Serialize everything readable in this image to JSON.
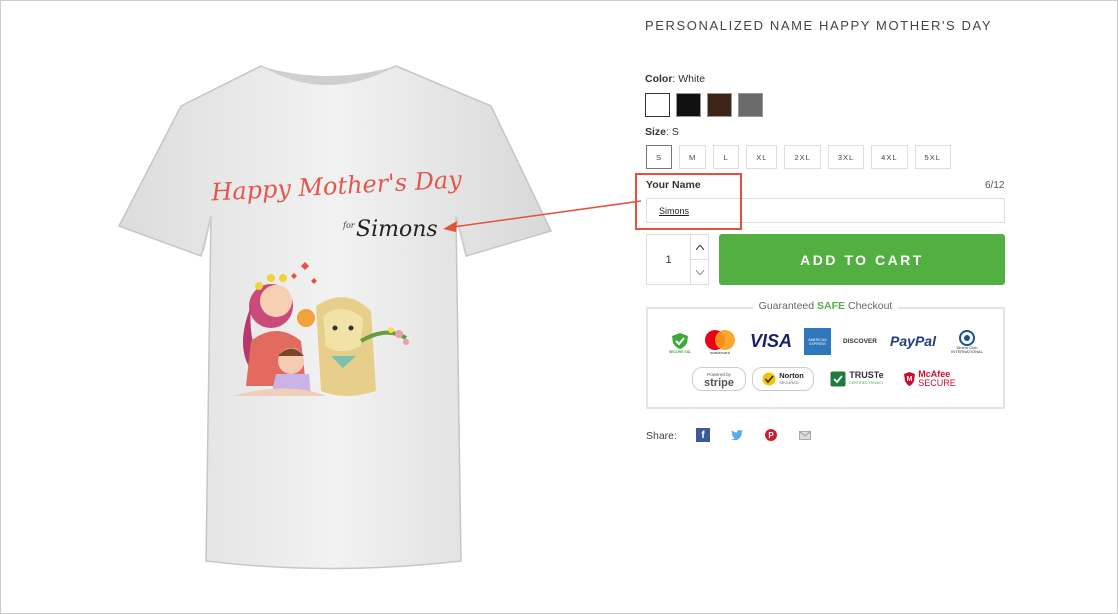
{
  "product": {
    "title": "PERSONALIZED NAME HAPPY MOTHER'S DAY",
    "shirt_text_main": "Happy Mother's Day",
    "shirt_text_for": "for",
    "shirt_text_name": "Simons"
  },
  "color": {
    "label": "Color",
    "selected": "White",
    "options": [
      {
        "name": "White",
        "hex": "#ffffff"
      },
      {
        "name": "Black",
        "hex": "#111111"
      },
      {
        "name": "Brown",
        "hex": "#3d2418"
      },
      {
        "name": "Gray",
        "hex": "#6b6b6b"
      }
    ]
  },
  "size": {
    "label": "Size",
    "selected": "S",
    "options": [
      "S",
      "M",
      "L",
      "XL",
      "2XL",
      "3XL",
      "4XL",
      "5XL"
    ]
  },
  "custom_name": {
    "label": "Your Name",
    "count": "6/12",
    "value": "Simons"
  },
  "quantity": {
    "value": "1",
    "up": "^",
    "down": "v"
  },
  "cart": {
    "add_label": "ADD TO CART",
    "accent": "#52b043"
  },
  "checkout": {
    "title_pre": "Guaranteed ",
    "title_safe": "SAFE",
    "title_post": " Checkout",
    "badges": {
      "secure_ssl": "SECURE SSL",
      "mastercard": "mastercard",
      "visa": "VISA",
      "amex": "AMERICAN EXPRESS",
      "discover": "DISCOVER",
      "paypal": "PayPal",
      "diners": "Diners Club INTERNATIONAL",
      "stripe_top": "Powered by",
      "stripe": "stripe",
      "norton": "Norton",
      "norton_sub": "SECURED",
      "truste": "TRUSTe",
      "truste_sub": "CERTIFIED PRIVACY",
      "mcafee": "McAfee",
      "mcafee_sub": "SECURE"
    }
  },
  "share": {
    "label": "Share:",
    "icons": [
      "facebook-icon",
      "twitter-icon",
      "pinterest-icon",
      "email-icon"
    ]
  },
  "annotation": {
    "color": "#e4523c"
  }
}
